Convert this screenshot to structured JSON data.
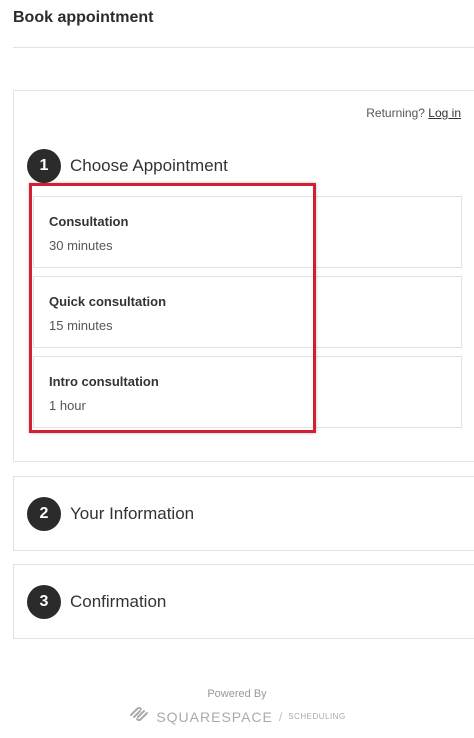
{
  "header": {
    "title": "Book appointment"
  },
  "returning": {
    "prefix": "Returning?",
    "link": "Log in"
  },
  "steps": [
    {
      "number": "1",
      "title": "Choose Appointment"
    },
    {
      "number": "2",
      "title": "Your Information"
    },
    {
      "number": "3",
      "title": "Confirmation"
    }
  ],
  "appointments": [
    {
      "name": "Consultation",
      "duration": "30 minutes"
    },
    {
      "name": "Quick consultation",
      "duration": "15 minutes"
    },
    {
      "name": "Intro consultation",
      "duration": "1 hour"
    }
  ],
  "highlight": {
    "color": "#d21f34"
  },
  "footer": {
    "powered_by": "Powered By",
    "brand": "SQUARESPACE",
    "separator": "/",
    "sub": "SCHEDULING",
    "logo_icon": "squarespace-logo-icon"
  }
}
